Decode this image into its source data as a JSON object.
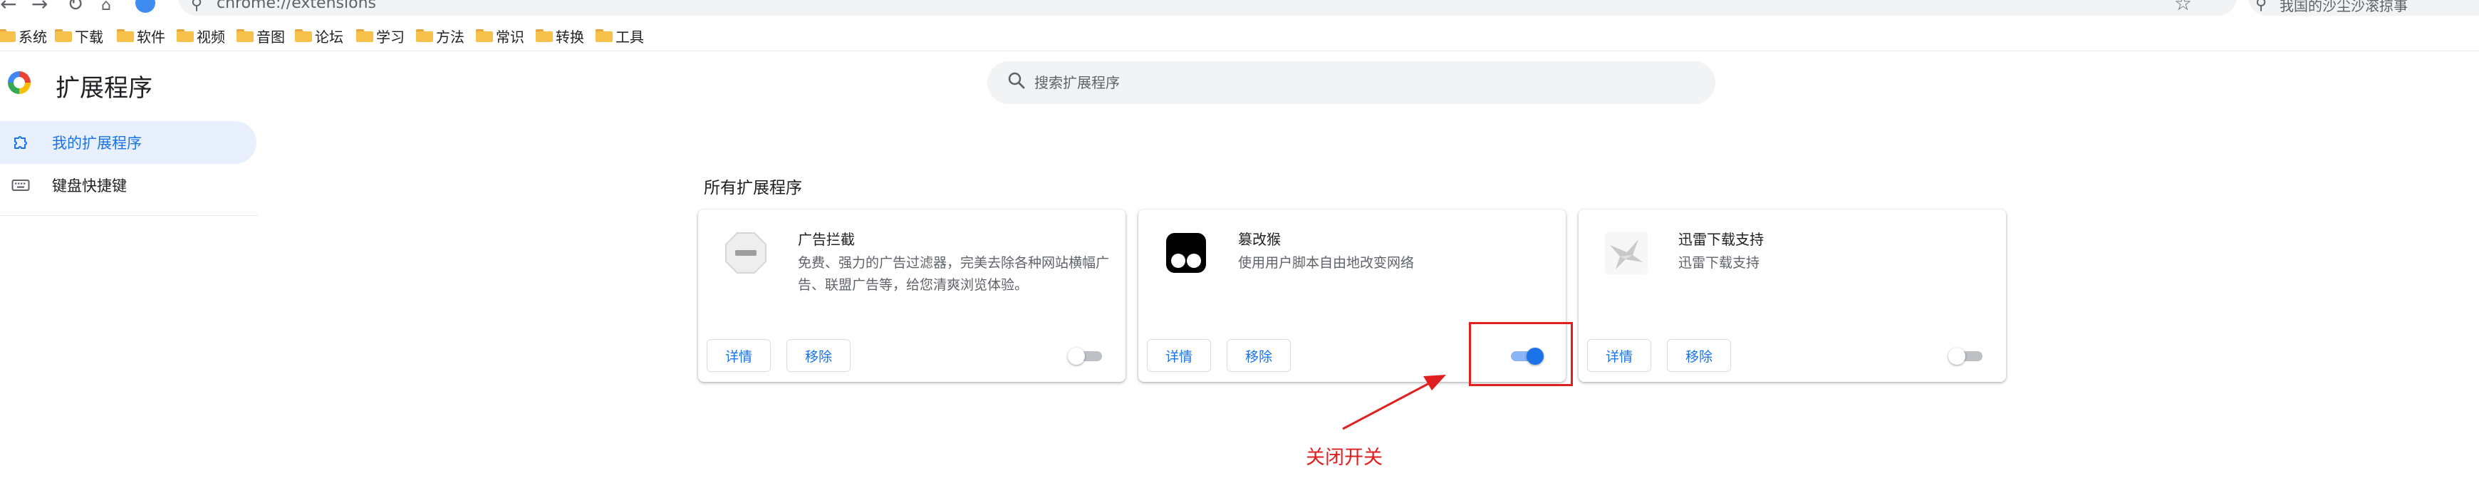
{
  "browser": {
    "address": "chrome://extensions",
    "side_search_placeholder": "我国的沙尘沙滚掠事"
  },
  "bookmarks": [
    "系统",
    "下载",
    "软件",
    "视频",
    "音图",
    "论坛",
    "学习",
    "方法",
    "常识",
    "转换",
    "工具"
  ],
  "header": {
    "title": "扩展程序",
    "search_placeholder": "搜索扩展程序"
  },
  "sidebar": {
    "items": [
      {
        "label": "我的扩展程序",
        "icon": "puzzle-icon",
        "active": true
      },
      {
        "label": "键盘快捷键",
        "icon": "keyboard-icon",
        "active": false
      }
    ]
  },
  "main": {
    "section_title": "所有扩展程序",
    "extensions": [
      {
        "name": "广告拦截",
        "description": "免费、强力的广告过滤器，完美去除各种网站横幅广告、联盟广告等，给您清爽浏览体验。",
        "icon": "stop-sign-icon",
        "details_label": "详情",
        "remove_label": "移除",
        "enabled": false
      },
      {
        "name": "篡改猴",
        "description": "使用用户脚本自由地改变网络",
        "icon": "tampermonkey-icon",
        "details_label": "详情",
        "remove_label": "移除",
        "enabled": true
      },
      {
        "name": "迅雷下载支持",
        "description": "迅雷下载支持",
        "icon": "thunder-bird-icon",
        "details_label": "详情",
        "remove_label": "移除",
        "enabled": false
      }
    ]
  },
  "annotation": {
    "label": "关闭开关",
    "color": "#e02020"
  },
  "colors": {
    "accent": "#1a73e8",
    "active_bg": "#e8f0fe",
    "toggle_off": "#bdc1c6"
  }
}
